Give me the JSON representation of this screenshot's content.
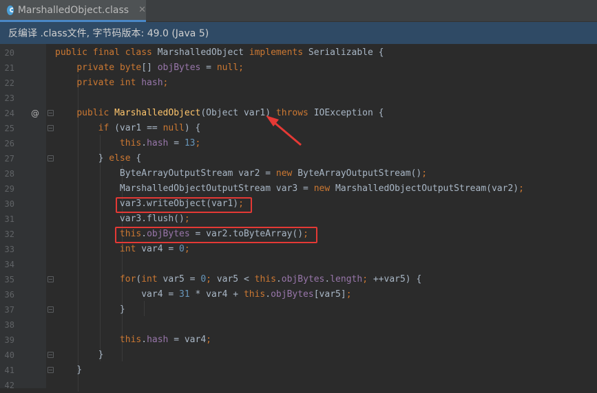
{
  "tab": {
    "label": "MarshalledObject.class",
    "close": "✕",
    "icon": "java-class-icon"
  },
  "info_bar": "反编译 .class文件, 字节码版本: 49.0 (Java 5)",
  "gutter_marker": "@",
  "colors": {
    "keyword": "#cc7832",
    "field": "#9876aa",
    "number": "#6897bb",
    "method_decl": "#ffc66d",
    "text": "#a9b7c6",
    "highlight_box": "#e53935"
  },
  "lines": [
    {
      "no": "20",
      "t": [
        [
          "k",
          "public final class "
        ],
        [
          "",
          "MarshalledObject "
        ],
        [
          "k",
          "implements "
        ],
        [
          "",
          "Serializable {"
        ]
      ]
    },
    {
      "no": "21",
      "t": [
        [
          "",
          "    "
        ],
        [
          "k",
          "private "
        ],
        [
          "k",
          "byte"
        ],
        [
          "",
          "[] "
        ],
        [
          "p",
          "objBytes"
        ],
        [
          "",
          " = "
        ],
        [
          "k",
          "null"
        ],
        [
          "k",
          ";"
        ]
      ]
    },
    {
      "no": "22",
      "t": [
        [
          "",
          "    "
        ],
        [
          "k",
          "private int "
        ],
        [
          "p",
          "hash"
        ],
        [
          "k",
          ";"
        ]
      ]
    },
    {
      "no": "23",
      "t": []
    },
    {
      "no": "24",
      "t": [
        [
          "",
          "    "
        ],
        [
          "k",
          "public "
        ],
        [
          "f",
          "MarshalledObject"
        ],
        [
          "",
          "(Object var1) "
        ],
        [
          "k",
          "throws "
        ],
        [
          "",
          "IOException {"
        ]
      ]
    },
    {
      "no": "25",
      "t": [
        [
          "",
          "        "
        ],
        [
          "k",
          "if "
        ],
        [
          "",
          "(var1 == "
        ],
        [
          "k",
          "null"
        ],
        [
          "",
          ") {"
        ]
      ]
    },
    {
      "no": "26",
      "t": [
        [
          "",
          "            "
        ],
        [
          "k",
          "this"
        ],
        [
          "",
          "."
        ],
        [
          "p",
          "hash"
        ],
        [
          "",
          " = "
        ],
        [
          "n",
          "13"
        ],
        [
          "k",
          ";"
        ]
      ]
    },
    {
      "no": "27",
      "t": [
        [
          "",
          "        } "
        ],
        [
          "k",
          "else "
        ],
        [
          "",
          "{"
        ]
      ]
    },
    {
      "no": "28",
      "t": [
        [
          "",
          "            ByteArrayOutputStream var2 = "
        ],
        [
          "k",
          "new "
        ],
        [
          "",
          "ByteArrayOutputStream()"
        ],
        [
          "k",
          ";"
        ]
      ]
    },
    {
      "no": "29",
      "t": [
        [
          "",
          "            MarshalledObjectOutputStream var3 = "
        ],
        [
          "k",
          "new "
        ],
        [
          "",
          "MarshalledObjectOutputStream(var2)"
        ],
        [
          "k",
          ";"
        ]
      ]
    },
    {
      "no": "30",
      "t": [
        [
          "",
          "            var3.writeObject(var1)"
        ],
        [
          "k",
          ";"
        ]
      ]
    },
    {
      "no": "31",
      "t": [
        [
          "",
          "            var3.flush()"
        ],
        [
          "k",
          ";"
        ]
      ]
    },
    {
      "no": "32",
      "t": [
        [
          "",
          "            "
        ],
        [
          "k",
          "this"
        ],
        [
          "",
          "."
        ],
        [
          "p",
          "objBytes"
        ],
        [
          "",
          " = var2.toByteArray()"
        ],
        [
          "k",
          ";"
        ]
      ]
    },
    {
      "no": "33",
      "t": [
        [
          "",
          "            "
        ],
        [
          "k",
          "int "
        ],
        [
          "",
          "var4 = "
        ],
        [
          "n",
          "0"
        ],
        [
          "k",
          ";"
        ]
      ]
    },
    {
      "no": "34",
      "t": []
    },
    {
      "no": "35",
      "t": [
        [
          "",
          "            "
        ],
        [
          "k",
          "for"
        ],
        [
          "",
          "("
        ],
        [
          "k",
          "int "
        ],
        [
          "",
          "var5 = "
        ],
        [
          "n",
          "0"
        ],
        [
          "k",
          "; "
        ],
        [
          "",
          "var5 < "
        ],
        [
          "k",
          "this"
        ],
        [
          "",
          "."
        ],
        [
          "p",
          "objBytes"
        ],
        [
          "",
          "."
        ],
        [
          "p",
          "length"
        ],
        [
          "k",
          "; "
        ],
        [
          "",
          "++var5) {"
        ]
      ]
    },
    {
      "no": "36",
      "t": [
        [
          "",
          "                var4 = "
        ],
        [
          "n",
          "31"
        ],
        [
          "",
          " * var4 + "
        ],
        [
          "k",
          "this"
        ],
        [
          "",
          "."
        ],
        [
          "p",
          "objBytes"
        ],
        [
          "",
          "[var5]"
        ],
        [
          "k",
          ";"
        ]
      ]
    },
    {
      "no": "37",
      "t": [
        [
          "",
          "            }"
        ]
      ]
    },
    {
      "no": "38",
      "t": []
    },
    {
      "no": "39",
      "t": [
        [
          "",
          "            "
        ],
        [
          "k",
          "this"
        ],
        [
          "",
          "."
        ],
        [
          "p",
          "hash"
        ],
        [
          "",
          " = var4"
        ],
        [
          "k",
          ";"
        ]
      ]
    },
    {
      "no": "40",
      "t": [
        [
          "",
          "        }"
        ]
      ]
    },
    {
      "no": "41",
      "t": [
        [
          "",
          "    }"
        ]
      ]
    },
    {
      "no": "42",
      "t": []
    }
  ]
}
